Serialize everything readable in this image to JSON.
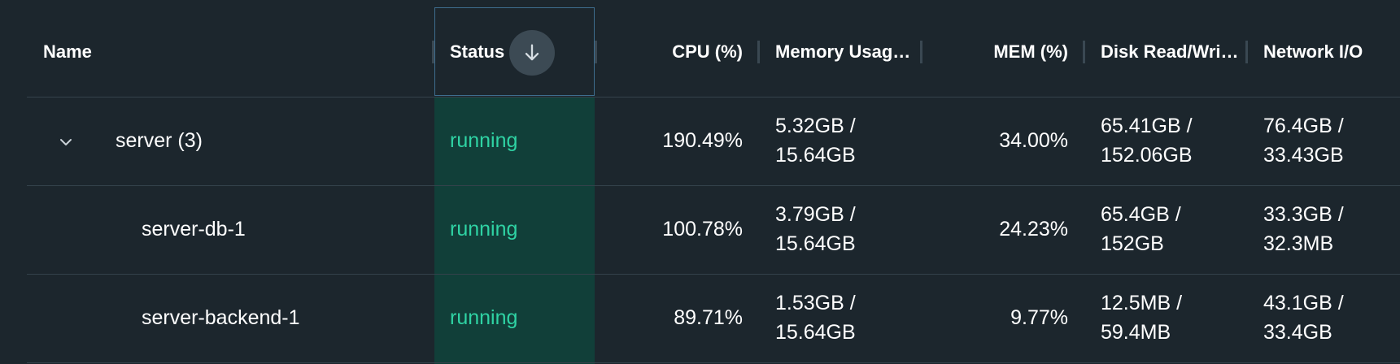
{
  "columns": {
    "name": "Name",
    "status": "Status",
    "cpu": "CPU (%)",
    "memory_usage": "Memory Usag…",
    "mem_pct": "MEM (%)",
    "disk": "Disk Read/Wri…",
    "network": "Network I/O"
  },
  "sort": {
    "column": "status",
    "direction": "descending",
    "icon": "arrow-down-icon"
  },
  "rows": [
    {
      "name": "server (3)",
      "expanded": true,
      "status": "running",
      "cpu": "190.49%",
      "mem_used": "5.32GB /",
      "mem_total": "15.64GB",
      "mem_pct": "34.00%",
      "disk_read": "65.41GB /",
      "disk_write": "152.06GB",
      "net_in": "76.4GB /",
      "net_out": "33.43GB"
    },
    {
      "name": "server-db-1",
      "status": "running",
      "cpu": "100.78%",
      "mem_used": "3.79GB /",
      "mem_total": "15.64GB",
      "mem_pct": "24.23%",
      "disk_read": "65.4GB /",
      "disk_write": "152GB",
      "net_in": "33.3GB /",
      "net_out": "32.3MB"
    },
    {
      "name": "server-backend-1",
      "status": "running",
      "cpu": "89.71%",
      "mem_used": "1.53GB /",
      "mem_total": "15.64GB",
      "mem_pct": "9.77%",
      "disk_read": "12.5MB /",
      "disk_write": "59.4MB",
      "net_in": "43.1GB /",
      "net_out": "33.4GB"
    }
  ],
  "colors": {
    "background": "#1c262d",
    "status_highlight": "#113f39",
    "status_text": "#2fd3a4",
    "header_focus_border": "#3e6d8e"
  }
}
